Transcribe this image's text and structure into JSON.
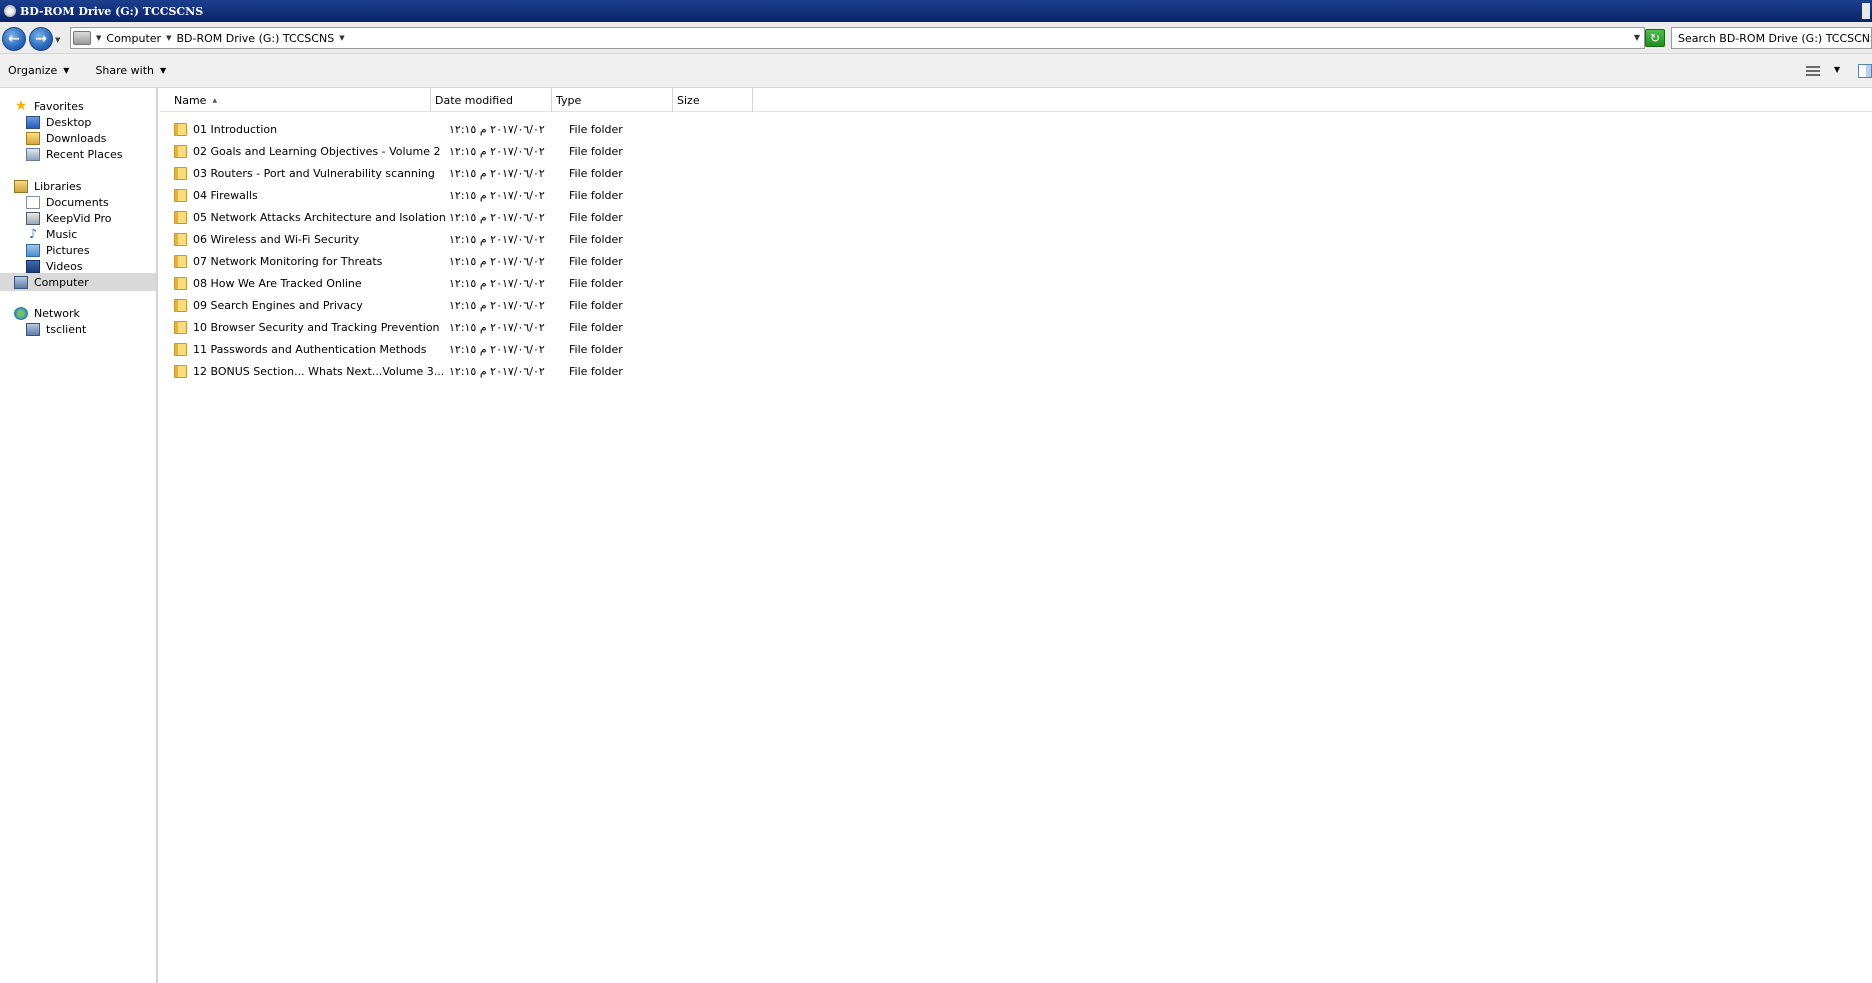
{
  "window": {
    "title": "BD-ROM Drive (G:) TCCSCNS"
  },
  "address": {
    "crumbs": [
      "Computer",
      "BD-ROM Drive (G:) TCCSCNS"
    ],
    "search_placeholder": "Search BD-ROM Drive (G:) TCCSCNS"
  },
  "toolbar": {
    "organize": "Organize",
    "share_with": "Share with"
  },
  "sidebar": {
    "favorites": "Favorites",
    "desktop": "Desktop",
    "downloads": "Downloads",
    "recent_places": "Recent Places",
    "libraries": "Libraries",
    "documents": "Documents",
    "keepvid": "KeepVid Pro",
    "music": "Music",
    "pictures": "Pictures",
    "videos": "Videos",
    "computer": "Computer",
    "network": "Network",
    "tsclient": "tsclient"
  },
  "columns": {
    "name": "Name",
    "date": "Date modified",
    "type": "Type",
    "size": "Size"
  },
  "files": [
    {
      "name": "01 Introduction",
      "date": "٢٠١٧/٠٦/٠٢ م ١٢:١٥",
      "type": "File folder"
    },
    {
      "name": "02 Goals and Learning Objectives - Volume 2",
      "date": "٢٠١٧/٠٦/٠٢ م ١٢:١٥",
      "type": "File folder"
    },
    {
      "name": "03 Routers - Port and Vulnerability scanning",
      "date": "٢٠١٧/٠٦/٠٢ م ١٢:١٥",
      "type": "File folder"
    },
    {
      "name": "04 Firewalls",
      "date": "٢٠١٧/٠٦/٠٢ م ١٢:١٥",
      "type": "File folder"
    },
    {
      "name": "05 Network Attacks Architecture and Isolation",
      "date": "٢٠١٧/٠٦/٠٢ م ١٢:١٥",
      "type": "File folder"
    },
    {
      "name": "06 Wireless and Wi-Fi Security",
      "date": "٢٠١٧/٠٦/٠٢ م ١٢:١٥",
      "type": "File folder"
    },
    {
      "name": "07 Network Monitoring for Threats",
      "date": "٢٠١٧/٠٦/٠٢ م ١٢:١٥",
      "type": "File folder"
    },
    {
      "name": "08 How We Are Tracked Online",
      "date": "٢٠١٧/٠٦/٠٢ م ١٢:١٥",
      "type": "File folder"
    },
    {
      "name": "09 Search Engines and Privacy",
      "date": "٢٠١٧/٠٦/٠٢ م ١٢:١٥",
      "type": "File folder"
    },
    {
      "name": "10 Browser Security and Tracking Prevention",
      "date": "٢٠١٧/٠٦/٠٢ م ١٢:١٥",
      "type": "File folder"
    },
    {
      "name": "11 Passwords and Authentication Methods",
      "date": "٢٠١٧/٠٦/٠٢ م ١٢:١٥",
      "type": "File folder"
    },
    {
      "name": "12 BONUS Section... Whats Next...Volume 3...",
      "date": "٢٠١٧/٠٦/٠٢ م ١٢:١٥",
      "type": "File folder"
    }
  ]
}
